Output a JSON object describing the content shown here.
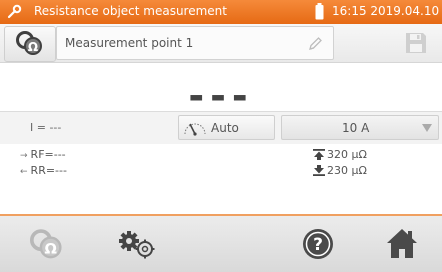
{
  "header": {
    "title": "Resistance object measurement",
    "datetime": "16:15 2019.04.10"
  },
  "measurement_point": {
    "name": "Measurement point 1"
  },
  "result": {
    "main_value": "---"
  },
  "parameters": {
    "current_label": "I = ---",
    "range_mode": "Auto",
    "test_current": "10 A"
  },
  "results": {
    "rf": "RF=---",
    "rr": "RR=---",
    "limit_upper": "320 µΩ",
    "limit_lower": "230 µΩ"
  },
  "colors": {
    "accent": "#e9711c",
    "toolbar": "#e3e3e3",
    "icon": "#4a4a4a",
    "disabled_icon": "#b8b8b8"
  },
  "icons": [
    "wrench-icon",
    "battery-icon",
    "resistance-object-icon",
    "pencil-icon",
    "save-icon",
    "gauge-icon",
    "dropdown-arrow-icon",
    "upper-limit-icon",
    "lower-limit-icon",
    "settings-icon",
    "help-icon",
    "home-icon"
  ]
}
